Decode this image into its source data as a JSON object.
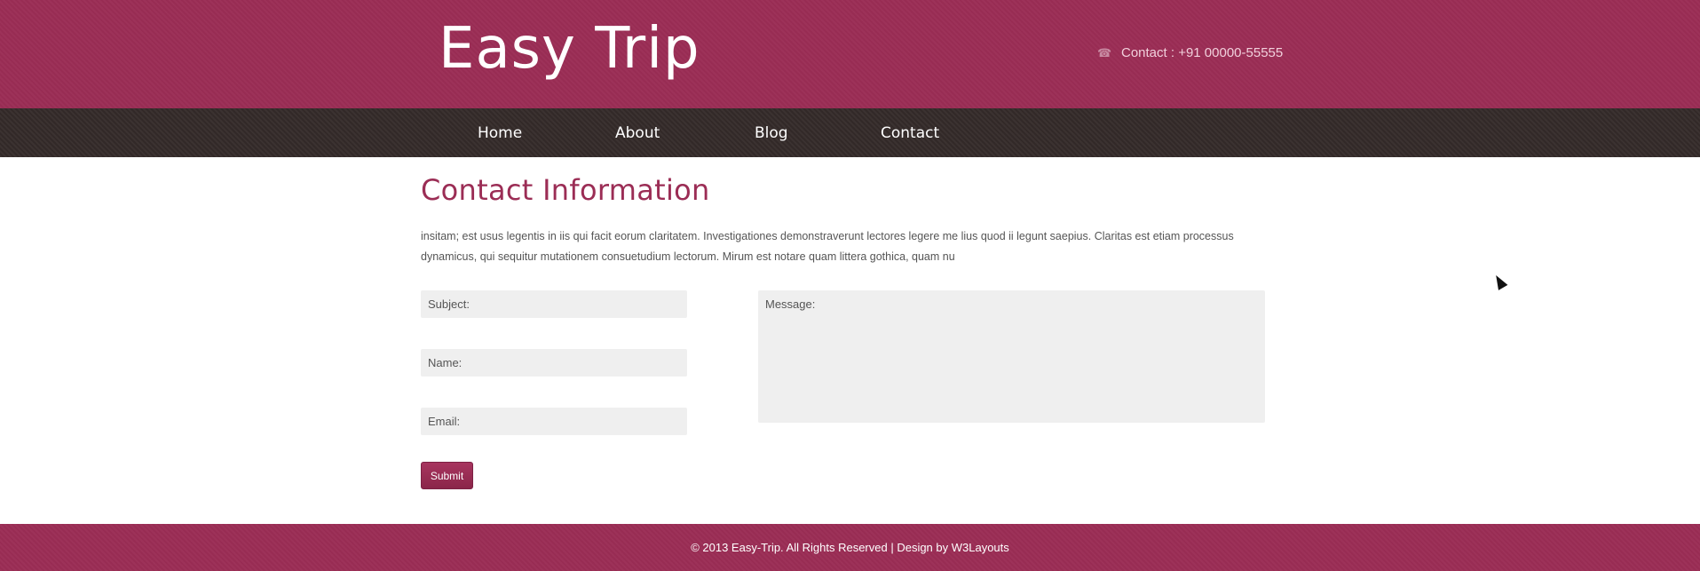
{
  "header": {
    "logo": "Easy Trip",
    "contact_icon": "phone-icon",
    "contact_text": "Contact : +91 00000-55555"
  },
  "nav": {
    "items": [
      {
        "label": "Home"
      },
      {
        "label": "About"
      },
      {
        "label": "Blog"
      },
      {
        "label": "Contact"
      }
    ]
  },
  "main": {
    "title": "Contact Information",
    "intro": "insitam; est usus legentis in iis qui facit eorum claritatem. Investigationes demonstraverunt lectores legere me lius quod ii legunt saepius. Claritas est etiam processus dynamicus, qui sequitur mutationem consuetudium lectorum. Mirum est notare quam littera gothica, quam nu",
    "form": {
      "subject_placeholder": "Subject:",
      "name_placeholder": "Name:",
      "email_placeholder": "Email:",
      "message_placeholder": "Message:",
      "submit_label": "Submit"
    }
  },
  "footer": {
    "text": "© 2013 Easy-Trip. All Rights Reserved | Design by W3Layouts"
  },
  "colors": {
    "brand": "#9b2d55",
    "nav_bg": "#352b2a",
    "field_bg": "#efefef"
  }
}
